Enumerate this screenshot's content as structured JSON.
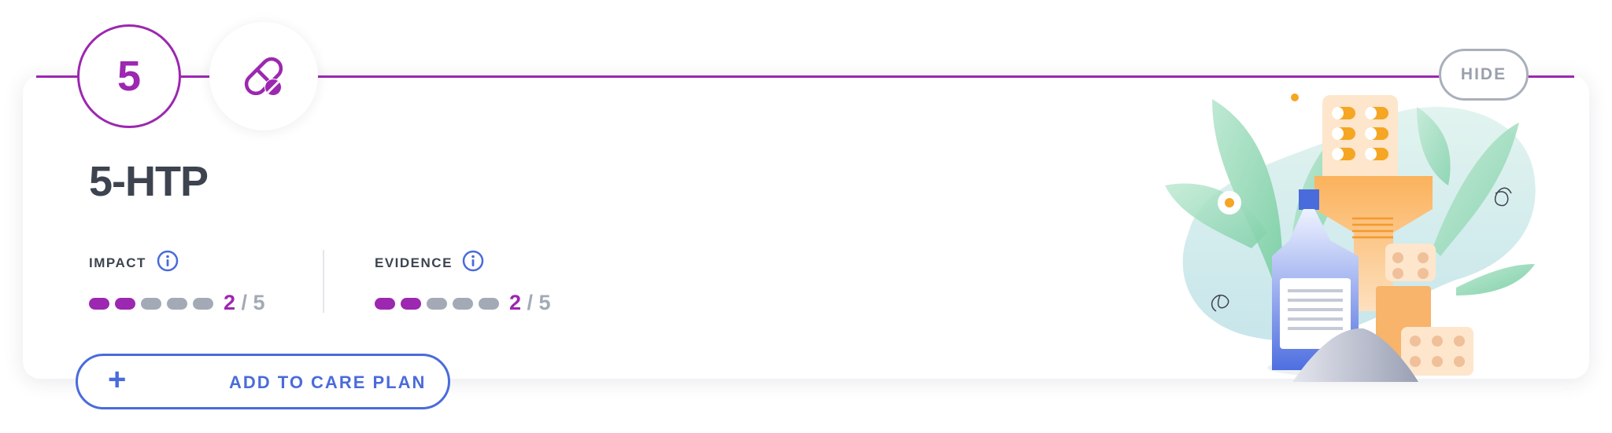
{
  "recommendation": {
    "rank": "5",
    "name": "5-HTP",
    "type_icon": "pill-capsule-icon",
    "hide_label": "HIDE",
    "add_label": "ADD TO CARE PLAN",
    "add_icon": "plus-icon"
  },
  "metrics": {
    "impact": {
      "label": "IMPACT",
      "score": "2",
      "max": "/ 5",
      "value": 2,
      "out_of": 5
    },
    "evidence": {
      "label": "EVIDENCE",
      "score": "2",
      "max": "/ 5",
      "value": 2,
      "out_of": 5
    }
  },
  "colors": {
    "accent": "#9c27b0",
    "action": "#4a6bdb",
    "inactive": "#a3aab6",
    "text": "#3d4450"
  }
}
